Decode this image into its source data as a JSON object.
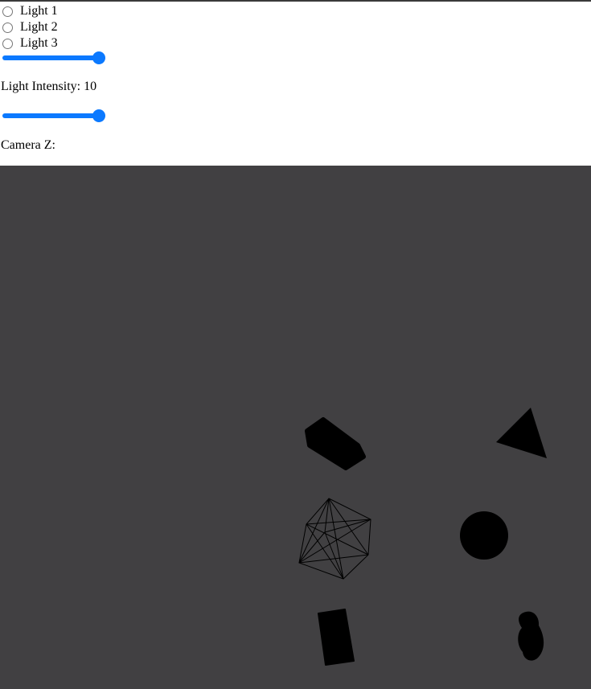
{
  "lights": [
    {
      "label": "Light 1",
      "selected": false
    },
    {
      "label": "Light 2",
      "selected": false
    },
    {
      "label": "Light 3",
      "selected": false
    }
  ],
  "intensity": {
    "label": "Light Intensity: 10",
    "slider_fraction": 1.0,
    "accent_color": "#0b79ff"
  },
  "camera": {
    "label": "Camera Z:",
    "slider_fraction": 1.0
  },
  "scene": {
    "background_color": "#414042",
    "objects": [
      {
        "name": "torus",
        "color": "#000000"
      },
      {
        "name": "cone",
        "color": "#000000"
      },
      {
        "name": "wireframe-icosahedron",
        "color": "#000000"
      },
      {
        "name": "sphere",
        "color": "#000000"
      },
      {
        "name": "cylinder",
        "color": "#000000"
      },
      {
        "name": "torus-knot",
        "color": "#000000"
      }
    ]
  }
}
